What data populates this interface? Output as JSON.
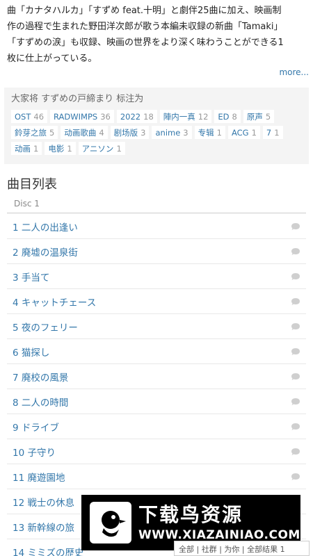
{
  "description": {
    "line1": "曲「カナタハルカ」「すずめ feat.十明」と劇伴25曲に加え、映画制",
    "line2": "作の過程で生まれた野田洋次郎が歌う本編未収録の新曲「Tamaki」",
    "line3": "「すずめの涙」も収録、映画の世界をより深く味わうことができる1",
    "line4": "枚に仕上がっている。",
    "more_link": "more..."
  },
  "tags": {
    "title": "大家将 すずめの戸締まり 标注为",
    "items": [
      {
        "label": "OST",
        "count": "46"
      },
      {
        "label": "RADWIMPS",
        "count": "36"
      },
      {
        "label": "2022",
        "count": "18"
      },
      {
        "label": "陣内一真",
        "count": "12"
      },
      {
        "label": "ED",
        "count": "8"
      },
      {
        "label": "原声",
        "count": "5"
      },
      {
        "label": "鈴芽之旅",
        "count": "5"
      },
      {
        "label": "动画歌曲",
        "count": "4"
      },
      {
        "label": "剧场版",
        "count": "3"
      },
      {
        "label": "anime",
        "count": "3"
      },
      {
        "label": "专辑",
        "count": "1"
      },
      {
        "label": "ACG",
        "count": "1"
      },
      {
        "label": "7",
        "count": "1"
      },
      {
        "label": "动画",
        "count": "1"
      },
      {
        "label": "电影",
        "count": "1"
      },
      {
        "label": "アニソン",
        "count": "1"
      }
    ]
  },
  "tracklist": {
    "title": "曲目列表",
    "disc": "Disc 1",
    "tracks": [
      "1 二人の出逢い",
      "2 廃墟の温泉街",
      "3 手当て",
      "4 キャットチェース",
      "5 夜のフェリー",
      "6 猫探し",
      "7 廃校の風景",
      "8 二人の時間",
      "9 ドライブ",
      "10 子守り",
      "11 廃遊園地",
      "12 戦士の休息",
      "13 新幹線の旅",
      "14 ミミズの歴史"
    ]
  },
  "watermark": {
    "title": "下载鸟资源",
    "url": "WWW.XIAZAINIAO.COM"
  },
  "bottom_bar": {
    "text": "全部 | 社群 | 为你 | 全部结果 1"
  },
  "colors": {
    "link": "#3377aa",
    "tag_bg": "#f4f4f4",
    "banner_bg": "#000000"
  }
}
